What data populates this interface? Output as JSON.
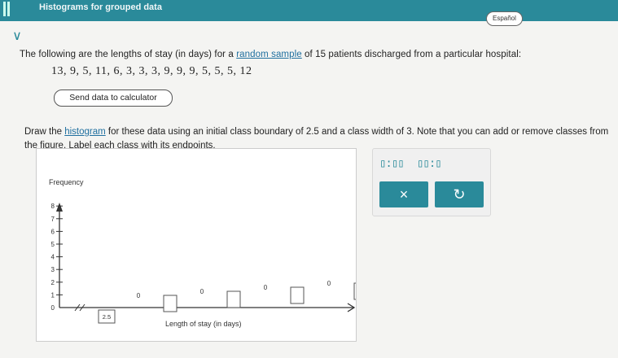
{
  "header": {
    "title": "Histograms for grouped data"
  },
  "language_button": "Español",
  "question": {
    "intro_before": "The following are the lengths of stay (in days) for a ",
    "intro_link": "random sample",
    "intro_after": " of 15 patients discharged from a particular hospital:",
    "values_text": "13, 9, 5, 11, 6, 3, 3, 3, 9, 9, 9, 5, 5, 5, 12",
    "send_button": "Send data to calculator",
    "instr_before": "Draw the ",
    "instr_link": "histogram",
    "instr_after": " for these data using an initial class boundary of 2.5 and a class width of 3. Note that you can add or remove classes from the figure. Label each class with its endpoints."
  },
  "graph": {
    "ylabel": "Frequency",
    "xlabel": "Length of stay (in days)",
    "y_ticks": [
      "0",
      "1",
      "2",
      "3",
      "4",
      "5",
      "6",
      "7",
      "8"
    ],
    "first_boundary": "2.5",
    "bar_values": [
      "0",
      "0",
      "0",
      "0"
    ]
  },
  "tools": {
    "icon_left": "▯:▯▯",
    "icon_right": "▯▯:▯",
    "clear_button": "×",
    "undo_button": "↻"
  },
  "colors": {
    "accent": "#2a8a9a",
    "link": "#1f6f9f"
  }
}
